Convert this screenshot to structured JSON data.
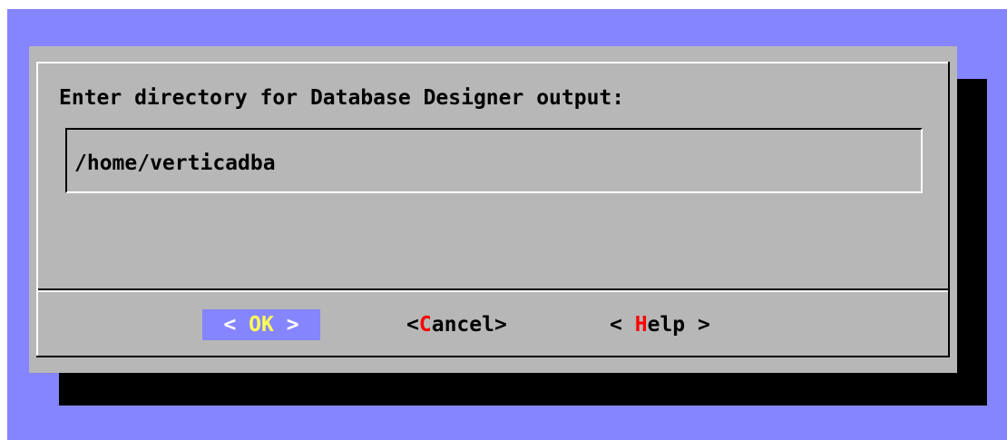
{
  "dialog": {
    "prompt": "Enter directory for Database Designer output:",
    "input_value": "/home/verticadba"
  },
  "buttons": {
    "ok": {
      "open": "< ",
      "hotkey": "OK",
      "rest": "",
      "close": " >"
    },
    "cancel": {
      "open": "<",
      "hotkey": "C",
      "rest": "ancel",
      "close": ">"
    },
    "help": {
      "open": "< ",
      "hotkey": "H",
      "rest": "elp",
      "close": " >"
    }
  },
  "colors": {
    "screen_background": "#8585ff",
    "dialog_background": "#b7b7b7",
    "shadow": "#000000",
    "selected_button": "#8585ff",
    "hotkey_selected": "#ffff55",
    "hotkey": "#ff0000"
  }
}
